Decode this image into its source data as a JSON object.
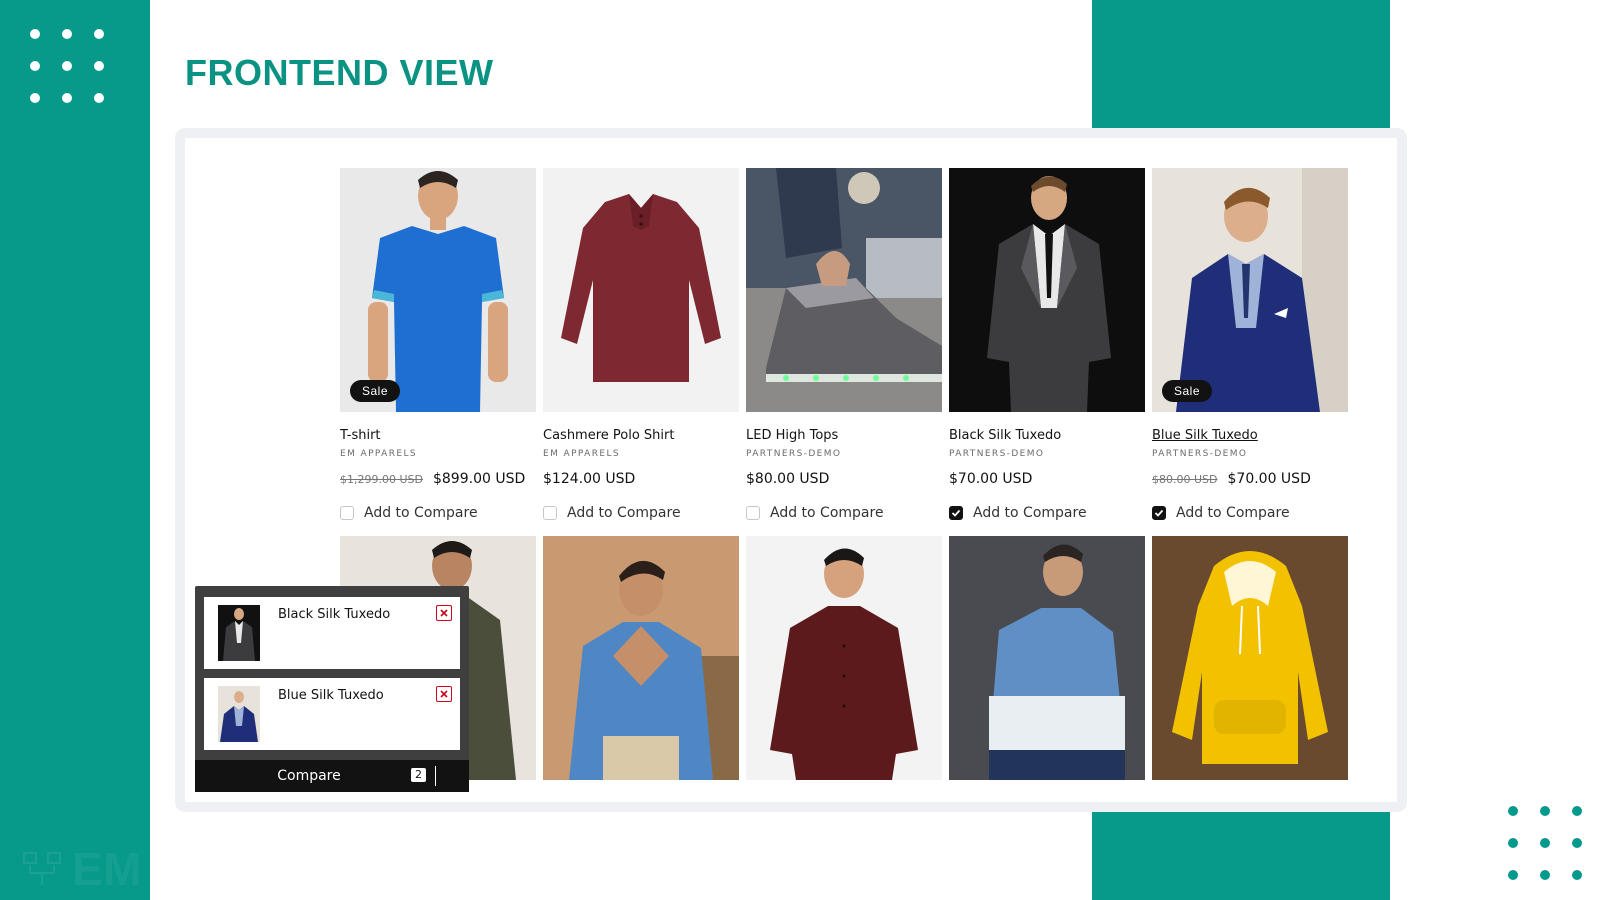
{
  "heading": "FRONTEND VIEW",
  "watermark": "EM SELECTPRO PRODUCT COMPARE",
  "colors": {
    "brand_teal": "#07998a",
    "heading_teal": "#0a9283",
    "sale_badge": "#121212",
    "remove_red": "#d0021b"
  },
  "products": [
    {
      "name": "T-shirt",
      "vendor": "EM APPARELS",
      "old_price": "$1,299.00 USD",
      "price": "$899.00 USD",
      "sale_label": "Sale",
      "compare_label": "Add to Compare",
      "checked": false
    },
    {
      "name": "Cashmere Polo Shirt",
      "vendor": "EM APPARELS",
      "old_price": "",
      "price": "$124.00 USD",
      "sale_label": "",
      "compare_label": "Add to Compare",
      "checked": false
    },
    {
      "name": "LED High Tops",
      "vendor": "PARTNERS-DEMO",
      "old_price": "",
      "price": "$80.00 USD",
      "sale_label": "",
      "compare_label": "Add to Compare",
      "checked": false
    },
    {
      "name": "Black Silk Tuxedo",
      "vendor": "PARTNERS-DEMO",
      "old_price": "",
      "price": "$70.00 USD",
      "sale_label": "",
      "compare_label": "Add to Compare",
      "checked": true
    },
    {
      "name": "Blue Silk Tuxedo",
      "vendor": "PARTNERS-DEMO",
      "old_price": "$80.00 USD",
      "price": "$70.00 USD",
      "sale_label": "Sale",
      "compare_label": "Add to Compare",
      "checked": true
    }
  ],
  "compare_panel": {
    "items": [
      {
        "name": "Black Silk Tuxedo",
        "remove_icon": "close-icon"
      },
      {
        "name": "Blue Silk Tuxedo",
        "remove_icon": "close-icon"
      }
    ],
    "button_label": "Compare",
    "count": "2"
  }
}
